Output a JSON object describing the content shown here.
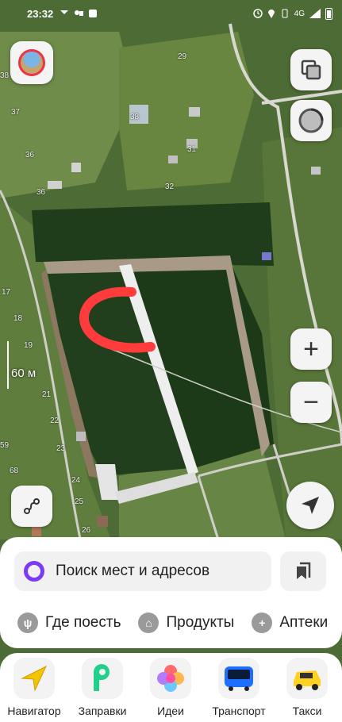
{
  "status_bar": {
    "time": "23:32",
    "network": "4G",
    "signal_text": "4G"
  },
  "map": {
    "plot_numbers": [
      "29",
      "38",
      "37",
      "38",
      "31",
      "36",
      "32",
      "36",
      "17",
      "18",
      "19",
      "21",
      "22",
      "23",
      "59",
      "68",
      "24",
      "25",
      "26"
    ],
    "scale_label": "60 м",
    "colors": {
      "drawn_line": "#ff3b3b",
      "forest": "#264a1f",
      "road": "#e0e0e0"
    }
  },
  "map_controls": {
    "profile": "avatar",
    "layers": "layers-icon",
    "traffic": "traffic-icon",
    "zoom_in": "+",
    "zoom_out": "−",
    "routes": "route-icon",
    "my_location": "navigation-arrow-icon"
  },
  "search": {
    "placeholder": "Поиск мест и адресов"
  },
  "categories": [
    {
      "label": "Где поесть",
      "icon": "fork-knife-icon",
      "glyph": "ψ"
    },
    {
      "label": "Продукты",
      "icon": "basket-icon",
      "glyph": "⌂"
    },
    {
      "label": "Аптеки",
      "icon": "pharmacy-cross-icon",
      "glyph": "+"
    }
  ],
  "apps": [
    {
      "label": "Навигатор",
      "icon": "navigator-icon"
    },
    {
      "label": "Заправки",
      "icon": "fuel-icon"
    },
    {
      "label": "Идеи",
      "icon": "ideas-icon"
    },
    {
      "label": "Транспорт",
      "icon": "bus-icon"
    },
    {
      "label": "Такси",
      "icon": "taxi-car-icon"
    }
  ]
}
